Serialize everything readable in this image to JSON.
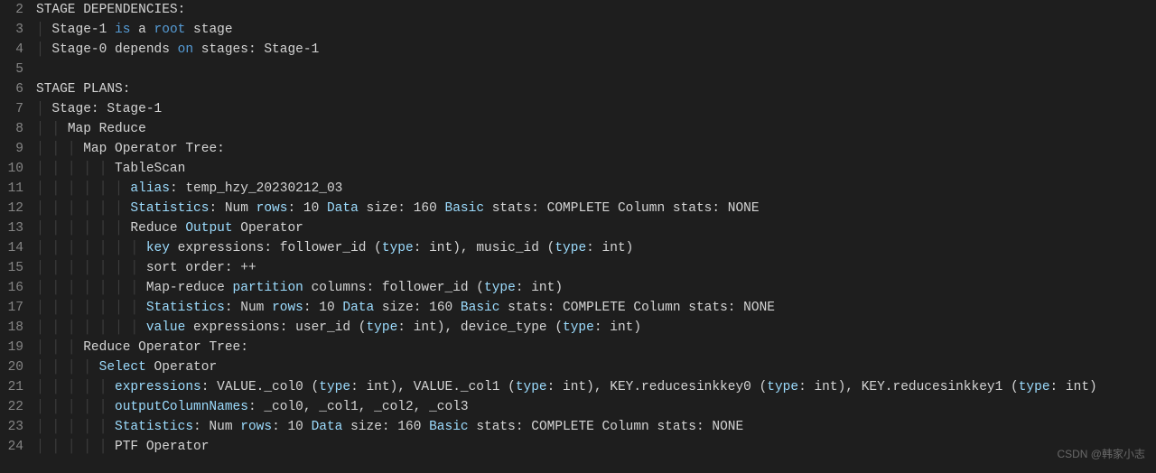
{
  "watermark": "CSDN @韩家小志",
  "gutter_start": 2,
  "gutter_end": 24,
  "lines": [
    {
      "indent": 0,
      "segs": [
        [
          "pale",
          "STAGE DEPENDENCIES:"
        ]
      ]
    },
    {
      "indent": 1,
      "segs": [
        [
          "pale",
          "Stage-1 "
        ],
        [
          "kw",
          "is"
        ],
        [
          "pale",
          " a "
        ],
        [
          "kw",
          "root"
        ],
        [
          "pale",
          " stage"
        ]
      ]
    },
    {
      "indent": 1,
      "segs": [
        [
          "pale",
          "Stage-0 depends "
        ],
        [
          "kw",
          "on"
        ],
        [
          "pale",
          " stages: Stage-1"
        ]
      ]
    },
    {
      "indent": 0,
      "segs": [
        [
          "pale",
          ""
        ]
      ]
    },
    {
      "indent": 0,
      "segs": [
        [
          "pale",
          "STAGE PLANS:"
        ]
      ]
    },
    {
      "indent": 1,
      "segs": [
        [
          "pale",
          "Stage: Stage-1"
        ]
      ]
    },
    {
      "indent": 2,
      "segs": [
        [
          "pale",
          "Map Reduce"
        ]
      ]
    },
    {
      "indent": 3,
      "segs": [
        [
          "pale",
          "Map Operator Tree:"
        ]
      ]
    },
    {
      "indent": 5,
      "segs": [
        [
          "pale",
          "TableScan"
        ]
      ]
    },
    {
      "indent": 6,
      "segs": [
        [
          "ident",
          "alias"
        ],
        [
          "pale",
          ": temp_hzy_20230212_03"
        ]
      ]
    },
    {
      "indent": 6,
      "segs": [
        [
          "ident",
          "Statistics"
        ],
        [
          "pale",
          ": Num "
        ],
        [
          "ident",
          "rows"
        ],
        [
          "pale",
          ": 10 "
        ],
        [
          "ident",
          "Data"
        ],
        [
          "pale",
          " size: 160 "
        ],
        [
          "ident",
          "Basic"
        ],
        [
          "pale",
          " stats: COMPLETE Column stats: NONE"
        ]
      ]
    },
    {
      "indent": 6,
      "segs": [
        [
          "pale",
          "Reduce "
        ],
        [
          "ident",
          "Output"
        ],
        [
          "pale",
          " Operator"
        ]
      ]
    },
    {
      "indent": 7,
      "segs": [
        [
          "ident",
          "key"
        ],
        [
          "pale",
          " expressions: follower_id ("
        ],
        [
          "ident",
          "type"
        ],
        [
          "pale",
          ": int), music_id ("
        ],
        [
          "ident",
          "type"
        ],
        [
          "pale",
          ": int)"
        ]
      ]
    },
    {
      "indent": 7,
      "segs": [
        [
          "pale",
          "sort order: ++"
        ]
      ]
    },
    {
      "indent": 7,
      "segs": [
        [
          "pale",
          "Map-reduce "
        ],
        [
          "ident",
          "partition"
        ],
        [
          "pale",
          " columns: follower_id ("
        ],
        [
          "ident",
          "type"
        ],
        [
          "pale",
          ": int)"
        ]
      ]
    },
    {
      "indent": 7,
      "segs": [
        [
          "ident",
          "Statistics"
        ],
        [
          "pale",
          ": Num "
        ],
        [
          "ident",
          "rows"
        ],
        [
          "pale",
          ": 10 "
        ],
        [
          "ident",
          "Data"
        ],
        [
          "pale",
          " size: 160 "
        ],
        [
          "ident",
          "Basic"
        ],
        [
          "pale",
          " stats: COMPLETE Column stats: NONE"
        ]
      ]
    },
    {
      "indent": 7,
      "segs": [
        [
          "ident",
          "value"
        ],
        [
          "pale",
          " expressions: user_id ("
        ],
        [
          "ident",
          "type"
        ],
        [
          "pale",
          ": int), device_type ("
        ],
        [
          "ident",
          "type"
        ],
        [
          "pale",
          ": int)"
        ]
      ]
    },
    {
      "indent": 3,
      "segs": [
        [
          "pale",
          "Reduce Operator Tree:"
        ]
      ]
    },
    {
      "indent": 4,
      "segs": [
        [
          "ident",
          "Select"
        ],
        [
          "pale",
          " Operator"
        ]
      ]
    },
    {
      "indent": 5,
      "segs": [
        [
          "ident",
          "expressions"
        ],
        [
          "pale",
          ": VALUE._col0 ("
        ],
        [
          "ident",
          "type"
        ],
        [
          "pale",
          ": int), VALUE._col1 ("
        ],
        [
          "ident",
          "type"
        ],
        [
          "pale",
          ": int), KEY.reducesinkkey0 ("
        ],
        [
          "ident",
          "type"
        ],
        [
          "pale",
          ": int), KEY.reducesinkkey1 ("
        ],
        [
          "ident",
          "type"
        ],
        [
          "pale",
          ": int)"
        ]
      ]
    },
    {
      "indent": 5,
      "segs": [
        [
          "ident",
          "outputColumnNames"
        ],
        [
          "pale",
          ": _col0, _col1, _col2, _col3"
        ]
      ]
    },
    {
      "indent": 5,
      "segs": [
        [
          "ident",
          "Statistics"
        ],
        [
          "pale",
          ": Num "
        ],
        [
          "ident",
          "rows"
        ],
        [
          "pale",
          ": 10 "
        ],
        [
          "ident",
          "Data"
        ],
        [
          "pale",
          " size: 160 "
        ],
        [
          "ident",
          "Basic"
        ],
        [
          "pale",
          " stats: COMPLETE Column stats: NONE"
        ]
      ]
    },
    {
      "indent": 5,
      "segs": [
        [
          "pale",
          "PTF Operator"
        ]
      ]
    }
  ]
}
